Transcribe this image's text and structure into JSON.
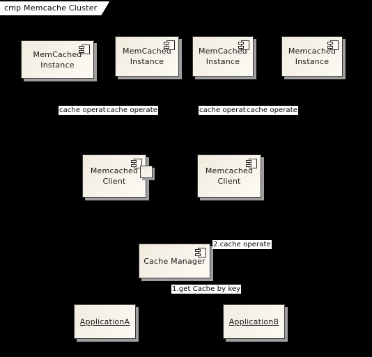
{
  "diagram": {
    "frame_label": "cmp Memcache Cluster",
    "background_color": "#000000",
    "node_fill_color": "#f7f2e9",
    "node_border_color": "#3b3b3b",
    "shadow_color": "#9e9e9e",
    "label_bg_color": "#ffffff",
    "label_text_color": "#000000"
  },
  "instances": [
    {
      "label": "MemCached\nInstance"
    },
    {
      "label": "MemCached\nInstance"
    },
    {
      "label": "MemCached\nInstance"
    },
    {
      "label": "Memcached\nInstance"
    }
  ],
  "clients": [
    {
      "label": "Memcached\nClient"
    },
    {
      "label": "Memcached\nClient"
    }
  ],
  "manager": {
    "label": "Cache Manager"
  },
  "applications": [
    {
      "label": "ApplicationA"
    },
    {
      "label": "ApplicationB"
    }
  ],
  "edge_labels": {
    "cache_operate_1a": "cache operate",
    "cache_operate_1b": "cache operate",
    "cache_operate_2a": "cache operate",
    "cache_operate_2b": "cache operate",
    "manager_to_client": "2.cache operate",
    "app_to_manager": "1.get Cache by key"
  },
  "icons": {
    "component": "component-icon",
    "port": "port-square"
  }
}
